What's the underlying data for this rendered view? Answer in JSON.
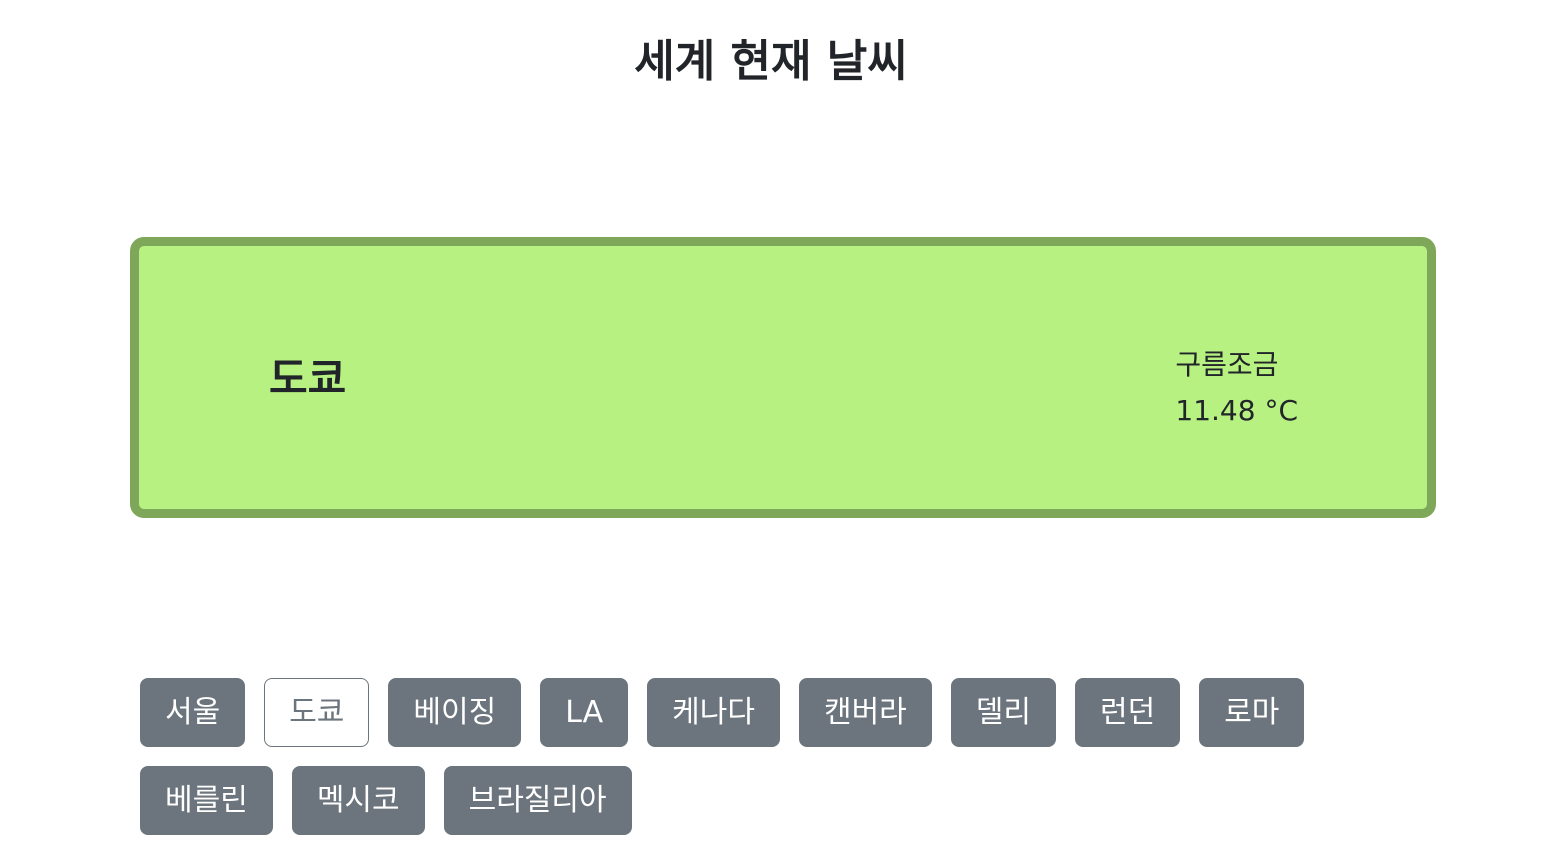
{
  "header": {
    "title": "세계 현재 날씨"
  },
  "weather": {
    "city": "도쿄",
    "description": "구름조금",
    "temperature": "11.48 °C"
  },
  "colors": {
    "card_background": "#b7f181",
    "card_border": "#7fa75a",
    "button_background": "#6c757d",
    "button_text": "#ffffff",
    "selected_button_background": "#ffffff"
  },
  "cities": [
    {
      "label": "서울",
      "selected": false
    },
    {
      "label": "도쿄",
      "selected": true
    },
    {
      "label": "베이징",
      "selected": false
    },
    {
      "label": "LA",
      "selected": false
    },
    {
      "label": "케나다",
      "selected": false
    },
    {
      "label": "캔버라",
      "selected": false
    },
    {
      "label": "델리",
      "selected": false
    },
    {
      "label": "런던",
      "selected": false
    },
    {
      "label": "로마",
      "selected": false
    },
    {
      "label": "베를린",
      "selected": false
    },
    {
      "label": "멕시코",
      "selected": false
    },
    {
      "label": "브라질리아",
      "selected": false
    }
  ]
}
